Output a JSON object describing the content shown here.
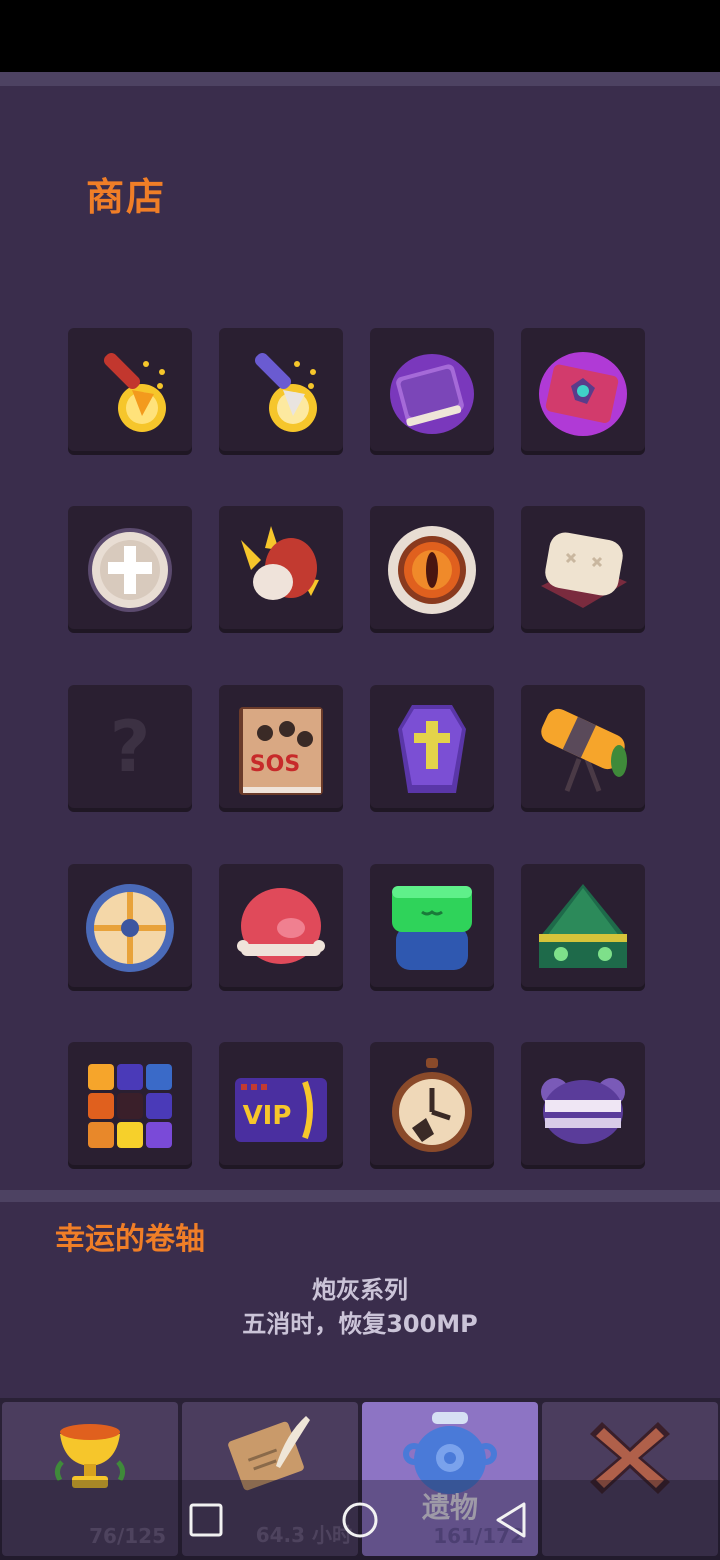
{
  "shop": {
    "title": "商店"
  },
  "slots": [
    {
      "icon": "gold-arrow-icon"
    },
    {
      "icon": "silver-arrow-icon"
    },
    {
      "icon": "purple-spellbook-icon"
    },
    {
      "icon": "red-spellbook-icon"
    },
    {
      "icon": "holy-cross-coin-icon"
    },
    {
      "icon": "raw-meat-icon"
    },
    {
      "icon": "fire-eye-icon"
    },
    {
      "icon": "pillow-icon"
    },
    {
      "icon": "unknown-icon",
      "label": "?"
    },
    {
      "icon": "photo-book-icon",
      "label": "SOS"
    },
    {
      "icon": "purple-coffin-icon"
    },
    {
      "icon": "telescope-icon"
    },
    {
      "icon": "round-shield-icon"
    },
    {
      "icon": "pig-head-icon"
    },
    {
      "icon": "green-frog-icon"
    },
    {
      "icon": "green-tent-icon"
    },
    {
      "icon": "color-cube-icon"
    },
    {
      "icon": "vip-card-icon",
      "label": "VIP"
    },
    {
      "icon": "pocket-watch-icon"
    },
    {
      "icon": "purple-hat-icon"
    }
  ],
  "selected_item": {
    "name": "幸运的卷轴",
    "desc_line1": "炮灰系列",
    "desc_line2": "五消时，恢复300MP"
  },
  "tabs": [
    {
      "icon": "golden-trophy-icon",
      "count": "76/125"
    },
    {
      "icon": "scroll-quill-icon",
      "count": "64.3 小时"
    },
    {
      "icon": "blue-vase-icon",
      "label": "遗物",
      "count": "161/172"
    },
    {
      "icon": "close-x-icon"
    }
  ],
  "colors": {
    "accent": "#f07e27",
    "bg": "#3a2d4c",
    "slot": "#2a1f31",
    "active_tab": "#8d74c4"
  }
}
